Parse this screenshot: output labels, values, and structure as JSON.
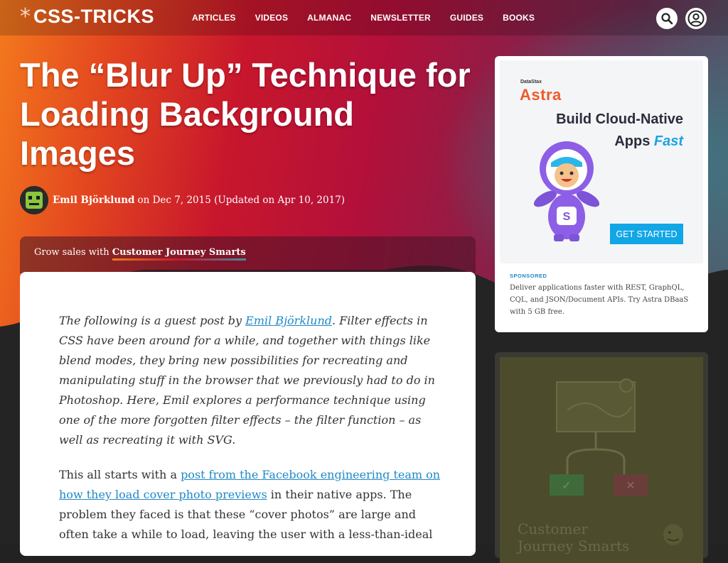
{
  "site": {
    "logo_symbol": "*",
    "logo_text": "CSS-TRICKS"
  },
  "nav": {
    "items": [
      "ARTICLES",
      "VIDEOS",
      "ALMANAC",
      "NEWSLETTER",
      "GUIDES",
      "BOOKS"
    ]
  },
  "header_icons": [
    "search-icon",
    "user-icon"
  ],
  "article": {
    "title": "The “Blur Up” Technique for Loading Background Images",
    "author": "Emil Björklund",
    "date_text": "on Dec 7, 2015 (Updated on Apr 10, 2017)",
    "promo_prefix": "Grow sales with",
    "promo_link": "Customer Journey Smarts",
    "p1_before": "The following is a guest post by ",
    "p1_link": "Emil Björklund",
    "p1_after": ". Filter effects in CSS have been around for a while, and together with things like blend modes, they bring new possibilities for recreating and manipulating stuff in the browser that we previously had to do in Photoshop. Here, Emil explores a performance technique using one of the more forgotten filter effects – the filter function – as well as recreating it with SVG.",
    "p2_before": "This all starts with a ",
    "p2_link": "post from the Facebook engineering team on how they load cover photo previews",
    "p2_after": " in their native apps. The problem they faced is that these “cover photos” are large and often take a while to load, leaving the user with a less-than-ideal"
  },
  "ad": {
    "brand_small": "DataStax",
    "brand": "Astra",
    "headline_1": "Build Cloud-Native",
    "headline_2": "Apps",
    "headline_2_em": "Fast",
    "cta": "GET STARTED",
    "sponsored_label": "SPONSORED",
    "description": "Deliver applications faster with REST, GraphQL, CQL, and JSON/Document APIs. Try Astra DBaaS with 5 GB free.",
    "mascot_badge": "S"
  },
  "ad2": {
    "title": "Customer Journey Smarts",
    "check_symbol": "✓",
    "cross_symbol": "✕"
  },
  "colors": {
    "accent": "#2089c7",
    "brand_orange": "#f47a1e",
    "brand_red": "#c8172c",
    "astra_orange": "#ef5a2a",
    "cta_blue": "#11a6e6"
  }
}
